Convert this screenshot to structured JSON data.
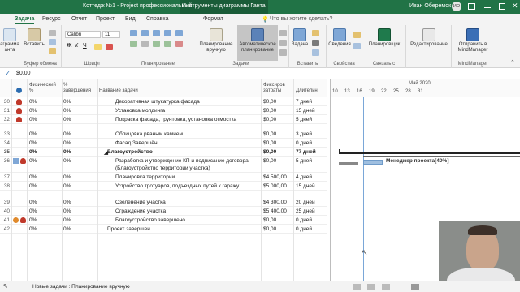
{
  "titlebar": {
    "app_title": "Коттедж №1  -  Project профессиональный",
    "tools_context": "Инструменты диаграммы Ганта",
    "user": "Иван Оберемок",
    "avatar_initials": "ИО"
  },
  "tabs": [
    "Задача",
    "Ресурс",
    "Отчет",
    "Проект",
    "Вид",
    "Справка",
    "Формат"
  ],
  "tell_me": "Что вы хотите сделать?",
  "ribbon": {
    "view_label": "аграмма\nанта",
    "insert_clip": "Вставить",
    "clipboard_group": "Буфер обмена",
    "font_name": "Calibri",
    "font_size": "11",
    "font_group": "Шрифт",
    "schedule_group": "Планирование",
    "manual_label": "Планирование\nвручную",
    "auto_label": "Автоматическое\nпланирование",
    "tasks_group": "Задачи",
    "task_label": "Задача",
    "insert_group": "Вставить",
    "info_label": "Сведения",
    "properties_group": "Свойства",
    "planner_label": "Планировщик",
    "teams_group": "Связать с",
    "edit_label": "Редактирование",
    "send_label": "Отправить в\nMindManager",
    "mindmanager_group": "MindManager"
  },
  "formula_value": "$0,00",
  "columns": {
    "physical": "Физический\n%",
    "complete": "%\nзавершения",
    "name": "Название задачи",
    "fixed_costs": "Фиксиров\nзатраты",
    "duration": "Длительн"
  },
  "rows": [
    {
      "num": "30",
      "phys": "0%",
      "comp": "0%",
      "name": "Декоративная штукатурка фасада",
      "cost": "$0,00",
      "dur": "7 дней",
      "ind": "person",
      "bold": false,
      "indent": 2
    },
    {
      "num": "31",
      "phys": "0%",
      "comp": "0%",
      "name": "Установка молдинга",
      "cost": "$0,00",
      "dur": "15 дней",
      "ind": "person",
      "bold": false,
      "indent": 2
    },
    {
      "num": "32",
      "phys": "0%",
      "comp": "0%",
      "name": "Покраска фасада, грунтовка, установка отмостка",
      "cost": "$0,00",
      "dur": "5 дней",
      "ind": "person",
      "bold": false,
      "indent": 2
    },
    {
      "num": "33",
      "phys": "0%",
      "comp": "0%",
      "name": "Облицовка рваным камнем",
      "cost": "$0,00",
      "dur": "3 дней",
      "ind": "",
      "bold": false,
      "indent": 2
    },
    {
      "num": "34",
      "phys": "0%",
      "comp": "0%",
      "name": "Фасад Завершён",
      "cost": "$0,00",
      "dur": "0 дней",
      "ind": "",
      "bold": false,
      "indent": 2
    },
    {
      "num": "35",
      "phys": "0%",
      "comp": "0%",
      "name": "Благоустройство",
      "cost": "$0,00",
      "dur": "77 дней",
      "ind": "",
      "bold": true,
      "indent": 1
    },
    {
      "num": "36",
      "phys": "0%",
      "comp": "0%",
      "name": "Разработка и утверждение КП и подписание договора",
      "name2": "(Благоустройство территории участка)",
      "cost": "$0,00",
      "dur": "5 дней",
      "ind": "grid-person",
      "bold": false,
      "indent": 2
    },
    {
      "num": "37",
      "phys": "0%",
      "comp": "0%",
      "name": "Планировка территории",
      "cost": "$4 500,00",
      "dur": "4 дней",
      "ind": "",
      "bold": false,
      "indent": 2
    },
    {
      "num": "38",
      "phys": "0%",
      "comp": "0%",
      "name": "Устройство тротуаров, подъездных путей к гаражу",
      "cost": "$5 000,00",
      "dur": "15 дней",
      "ind": "",
      "bold": false,
      "indent": 2
    },
    {
      "num": "39",
      "phys": "0%",
      "comp": "0%",
      "name": "Озеленение участка",
      "cost": "$4 300,00",
      "dur": "20 дней",
      "ind": "",
      "bold": false,
      "indent": 2
    },
    {
      "num": "40",
      "phys": "0%",
      "comp": "0%",
      "name": "Ограждение участка",
      "cost": "$5 400,00",
      "dur": "25 дней",
      "ind": "",
      "bold": false,
      "indent": 2
    },
    {
      "num": "41",
      "phys": "0%",
      "comp": "0%",
      "name": "Благоустройство завершено",
      "cost": "$0,00",
      "dur": "0 дней",
      "ind": "info-person",
      "bold": false,
      "indent": 2
    },
    {
      "num": "42",
      "phys": "0%",
      "comp": "0%",
      "name": "Проект завершен",
      "cost": "$0,00",
      "dur": "0 дней",
      "ind": "",
      "bold": false,
      "indent": 1
    }
  ],
  "gantt": {
    "month": "Май 2020",
    "days": [
      "10",
      "13",
      "16",
      "19",
      "22",
      "25",
      "28",
      "31"
    ],
    "resource_label": "Менеджер проекта[40%]"
  },
  "statusbar": {
    "mode": "Новые задачи : Планирование вручную"
  },
  "colors": {
    "brand": "#217346",
    "resource_icon": "#c0392b",
    "bar": "#9fbfe0"
  }
}
